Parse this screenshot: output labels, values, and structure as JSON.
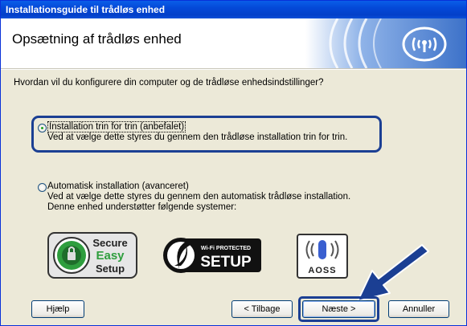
{
  "window": {
    "title": "Installationsguide til trådløs enhed"
  },
  "header": {
    "title": "Opsætning af trådløs enhed"
  },
  "question": "Hvordan vil du konfigurere din computer og de trådløse enhedsindstillinger?",
  "options": [
    {
      "label": "Installation trin for trin (anbefalet)",
      "description": "Ved at vælge dette styres du gennem den trådløse installation trin for trin.",
      "selected": true
    },
    {
      "label": "Automatisk installation (avanceret)",
      "description": "Ved at vælge dette styres du gennem den automatisk trådløse installation.",
      "description2": "Denne enhed understøtter følgende systemer:",
      "selected": false
    }
  ],
  "logos": {
    "ses": {
      "line1": "Secure",
      "line2": "Easy",
      "line3": "Setup"
    },
    "wps": {
      "top": "Wi-Fi PROTECTED",
      "main": "SETUP"
    },
    "aoss": {
      "text": "AOSS"
    }
  },
  "buttons": {
    "help": "Hjælp",
    "back": "< Tilbage",
    "next": "Næste >",
    "cancel": "Annuller"
  },
  "colors": {
    "title_bar": "#0449d8",
    "highlight": "#1b3f93",
    "ses_green": "#2e9e3e"
  }
}
